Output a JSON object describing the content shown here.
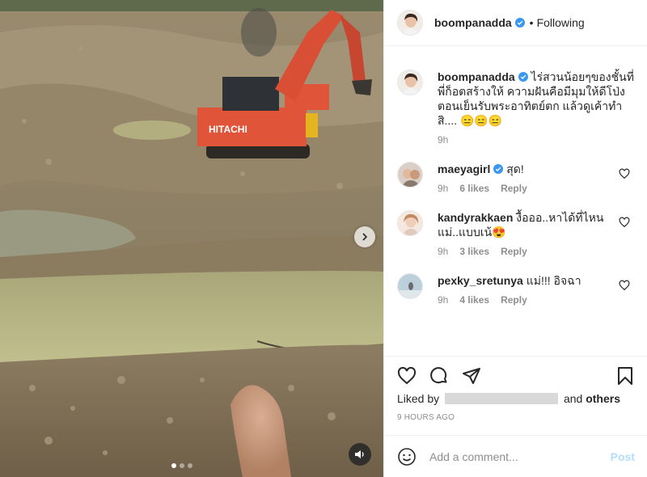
{
  "colors": {
    "accent": "#0095f6",
    "post_disabled": "#b2dffc",
    "secondary_text": "#8e8e8e",
    "border": "#efefef"
  },
  "media": {
    "vehicle_brand": "HITACHI",
    "next_icon": "chevron-right-icon",
    "sound_icon": "speaker-icon",
    "slides": 3,
    "active_slide": 1
  },
  "header": {
    "username": "boompanadda",
    "verified": true,
    "bullet": "•",
    "follow_label": "Following"
  },
  "caption": {
    "username": "boompanadda",
    "text": "ไร่สวนน้อยๆของชั้นที่พี่ก็อตสร้างให้ ความฝันคือมีมุมให้ดีโป่งตอนเย็นรับพระอาทิตย์ตก แล้วดูเค้าทำสิ.... 😑😑😑",
    "time": "9h"
  },
  "comments": [
    {
      "username": "maeyagirl",
      "verified": true,
      "text": "สุด!",
      "time": "9h",
      "likes": "6 likes",
      "reply": "Reply"
    },
    {
      "username": "kandyrakkaen",
      "verified": false,
      "text": "งื้อออ..หาได้ที่ไหนแม่..แบบเน้😍",
      "time": "9h",
      "likes": "3 likes",
      "reply": "Reply"
    },
    {
      "username": "pexky_sretunya",
      "verified": false,
      "text": "แม่!!! อิจฉา",
      "time": "9h",
      "likes": "4 likes",
      "reply": "Reply"
    }
  ],
  "actions": {
    "like_icon": "heart-icon",
    "comment_icon": "comment-icon",
    "share_icon": "paper-plane-icon",
    "save_icon": "bookmark-icon"
  },
  "likes": {
    "prefix": "Liked by",
    "suffix": "and",
    "others": "others"
  },
  "timestamp": "9 HOURS AGO",
  "add_comment": {
    "placeholder": "Add a comment...",
    "post_label": "Post"
  }
}
